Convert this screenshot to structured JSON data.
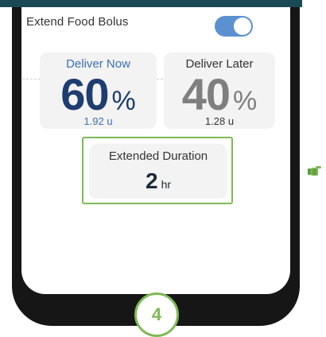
{
  "toggle": {
    "label": "Extend Food Bolus",
    "state": "on"
  },
  "deliver_now": {
    "title": "Deliver Now",
    "percent": "60",
    "unit": "%",
    "units": "1.92 u"
  },
  "deliver_later": {
    "title": "Deliver Later",
    "percent": "40",
    "unit": "%",
    "units": "1.28 u"
  },
  "duration": {
    "title": "Extended Duration",
    "value": "2",
    "unit": "hr"
  },
  "step": {
    "number": "4"
  },
  "colors": {
    "accent_green": "#7dba55",
    "toggle_blue": "#5b91d1",
    "navy": "#1e3d70"
  },
  "icons": {
    "pointer": "pointing-hand-icon"
  }
}
